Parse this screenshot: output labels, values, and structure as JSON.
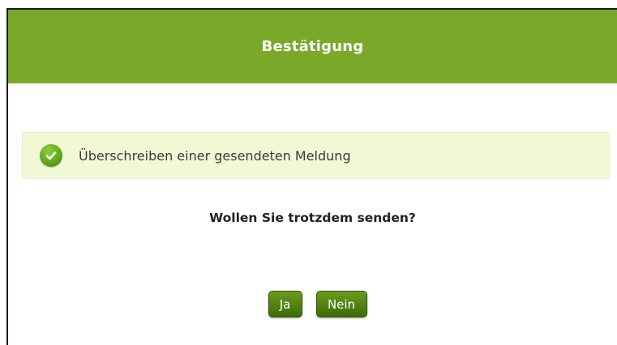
{
  "dialog": {
    "title": "Bestätigung",
    "message": "Überschreiben einer gesendeten Meldung",
    "message_icon": "check-circle-icon",
    "question": "Wollen Sie trotzdem senden?",
    "buttons": {
      "yes_label": "Ja",
      "no_label": "Nein"
    }
  },
  "colors": {
    "header": "#7aa829",
    "info_background": "#f0f8d4",
    "button": "#4f7d10",
    "check": "#5ea51a"
  }
}
